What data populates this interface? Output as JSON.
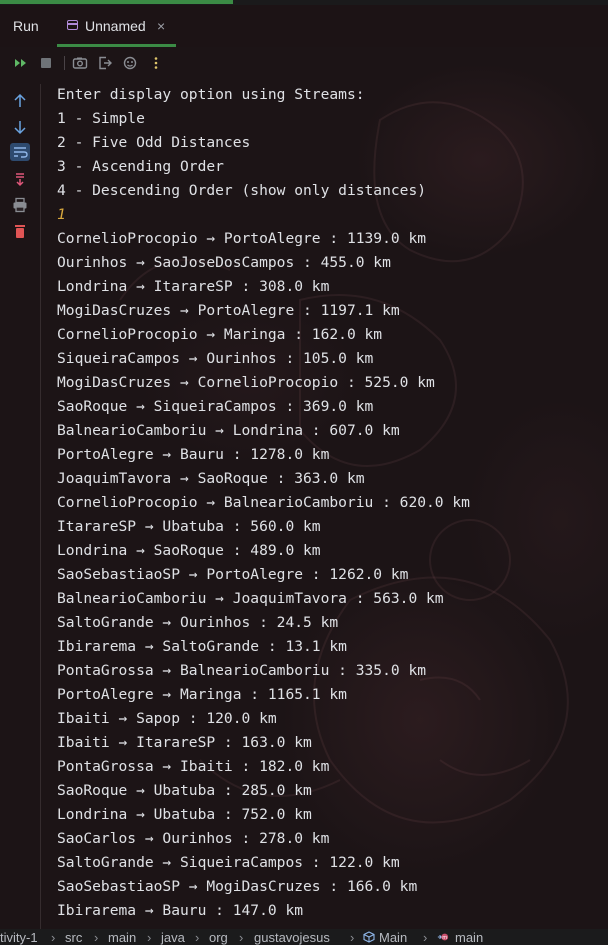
{
  "tabs": {
    "run_label": "Run",
    "active_tab_label": "Unnamed",
    "close_glyph": "×"
  },
  "toolbar": {
    "icons": [
      "rerun-icon",
      "stop-icon",
      "screenshot-icon",
      "exit-icon",
      "debug-icon",
      "more-icon"
    ]
  },
  "sidebar": {
    "icons": [
      "arrow-up-icon",
      "arrow-down-icon",
      "soft-wrap-icon",
      "scroll-to-end-icon",
      "print-icon",
      "delete-icon"
    ]
  },
  "console": {
    "lines": [
      "Enter display option using Streams:",
      "1 - Simple",
      "2 - Five Odd Distances",
      "3 - Ascending Order",
      "4 - Descending Order (show only distances)",
      "1",
      "CornelioProcopio → PortoAlegre : 1139.0 km",
      "Ourinhos → SaoJoseDosCampos : 455.0 km",
      "Londrina → ItarareSP : 308.0 km",
      "MogiDasCruzes → PortoAlegre : 1197.1 km",
      "CornelioProcopio → Maringa : 162.0 km",
      "SiqueiraCampos → Ourinhos : 105.0 km",
      "MogiDasCruzes → CornelioProcopio : 525.0 km",
      "SaoRoque → SiqueiraCampos : 369.0 km",
      "BalnearioCamboriu → Londrina : 607.0 km",
      "PortoAlegre → Bauru : 1278.0 km",
      "JoaquimTavora → SaoRoque : 363.0 km",
      "CornelioProcopio → BalnearioCamboriu : 620.0 km",
      "ItarareSP → Ubatuba : 560.0 km",
      "Londrina → SaoRoque : 489.0 km",
      "SaoSebastiaoSP → PortoAlegre : 1262.0 km",
      "BalnearioCamboriu → JoaquimTavora : 563.0 km",
      "SaltoGrande → Ourinhos : 24.5 km",
      "Ibirarema → SaltoGrande : 13.1 km",
      "PontaGrossa → BalnearioCamboriu : 335.0 km",
      "PortoAlegre → Maringa : 1165.1 km",
      "Ibaiti → Sapop : 120.0 km",
      "Ibaiti → ItarareSP : 163.0 km",
      "PontaGrossa → Ibaiti : 182.0 km",
      "SaoRoque → Ubatuba : 285.0 km",
      "Londrina → Ubatuba : 752.0 km",
      "SaoCarlos → Ourinhos : 278.0 km",
      "SaltoGrande → SiqueiraCampos : 122.0 km",
      "SaoSebastiaoSP → MogiDasCruzes : 166.0 km",
      "Ibirarema → Bauru : 147.0 km"
    ],
    "input_line_index": 5
  },
  "statusbar": {
    "crumbs": [
      "tivity-1",
      "src",
      "main",
      "java",
      "org",
      "gustavojesus",
      "Main",
      "main"
    ],
    "separator": "›"
  },
  "colors": {
    "accent_green": "#3b8b45",
    "input_text": "#d9a93e",
    "background": "#1c1416"
  }
}
